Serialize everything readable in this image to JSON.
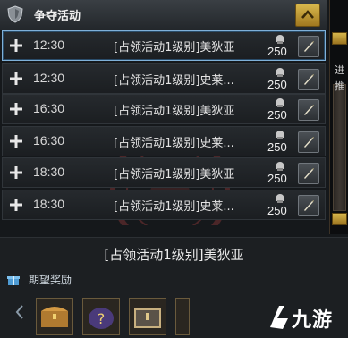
{
  "header": {
    "title": "争夺活动"
  },
  "rows": [
    {
      "time": "12:30",
      "activity": "[占领活动1级别]美狄亚",
      "count": "250",
      "selected": true
    },
    {
      "time": "12:30",
      "activity": "[占领活动1级别]史莱...",
      "count": "250"
    },
    {
      "time": "16:30",
      "activity": "[占领活动1级别]美狄亚",
      "count": "250"
    },
    {
      "time": "16:30",
      "activity": "[占领活动1级别]史莱...",
      "count": "250"
    },
    {
      "time": "18:30",
      "activity": "[占领活动1级别]美狄亚",
      "count": "250"
    },
    {
      "time": "18:30",
      "activity": "[占领活动1级别]史莱...",
      "count": "250"
    }
  ],
  "side_panel": {
    "line1": "进",
    "line2": "推"
  },
  "detail": {
    "title": "[占领活动1级别]美狄亚",
    "reward_label": "期望奖励"
  },
  "watermark": {
    "text": "九游"
  },
  "icons": {
    "header": "shield-icon",
    "collapse": "chevron-up-icon",
    "row_expand": "plus-icon",
    "row_currency": "helmet-icon",
    "row_action": "quill-pen-icon",
    "reward": "gift-icon",
    "nav_prev": "chevron-left-icon"
  },
  "colors": {
    "accent_gold": "#c9a43c",
    "selected_border": "#7fb0d8"
  }
}
